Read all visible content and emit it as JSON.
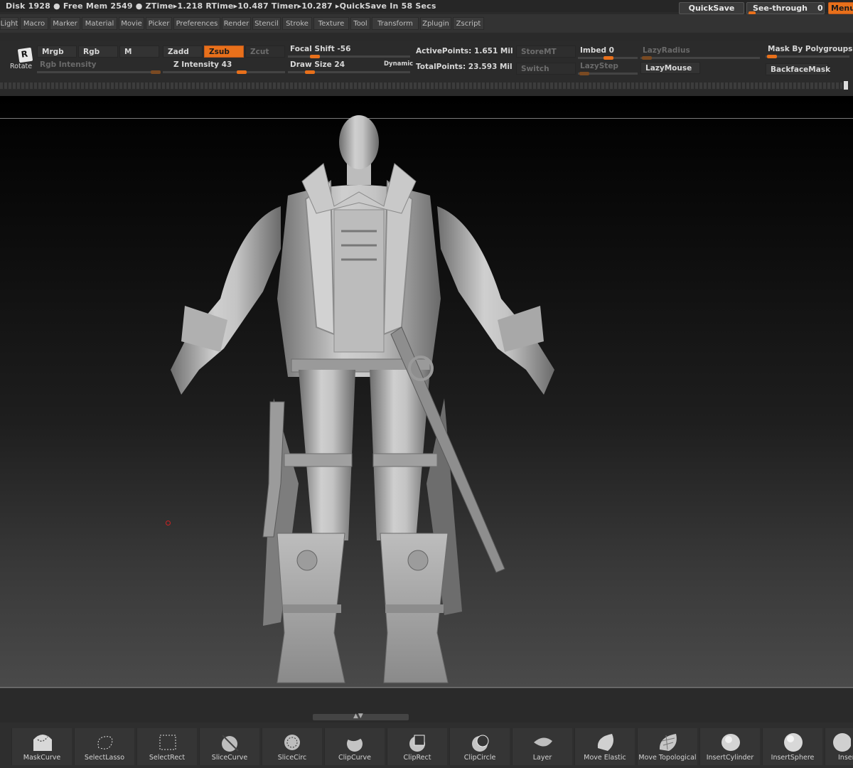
{
  "status": {
    "text": "Disk 1928 ● Free Mem 2549 ● ZTime▸1.218 RTime▸10.487 Timer▸10.287 ▸QuickSave In 58 Secs"
  },
  "topright": {
    "quicksave": "QuickSave",
    "seethrough": "See-through",
    "seethrough_value": "0",
    "menus": "Menus"
  },
  "menu": [
    "Light",
    "Macro",
    "Marker",
    "Material",
    "Movie",
    "Picker",
    "Preferences",
    "Render",
    "Stencil",
    "Stroke",
    "Texture",
    "Tool",
    "Transform",
    "Zplugin",
    "Zscript"
  ],
  "shelf": {
    "rotate": "Rotate",
    "rotate_key": "R",
    "mrgb": "Mrgb",
    "rgb": "Rgb",
    "m": "M",
    "zadd": "Zadd",
    "zsub": "Zsub",
    "zcut": "Zcut",
    "rgb_intensity": "Rgb Intensity",
    "z_intensity": "Z Intensity 43",
    "focal_shift": "Focal Shift -56",
    "draw_size": "Draw Size 24",
    "dynamic": "Dynamic",
    "active_points": "ActivePoints: 1.651  Mil",
    "total_points": "TotalPoints: 23.593  Mil",
    "storemt": "StoreMT",
    "switch": "Switch",
    "imbed": "Imbed 0",
    "lazystep": "LazyStep",
    "lazyradius": "LazyRadius",
    "lazymouse": "LazyMouse",
    "mask_by_polygroups": "Mask By Polygroups",
    "backfacemask": "BackfaceMask"
  },
  "tray": [
    "MaskCurve",
    "SelectLasso",
    "SelectRect",
    "SliceCurve",
    "SliceCirc",
    "ClipCurve",
    "ClipRect",
    "ClipCircle",
    "Layer",
    "Move Elastic",
    "Move Topological",
    "InsertCylinder",
    "InsertSphere",
    "Inser"
  ],
  "colors": {
    "accent": "#e8701b",
    "bg": "#2a2a2a"
  }
}
